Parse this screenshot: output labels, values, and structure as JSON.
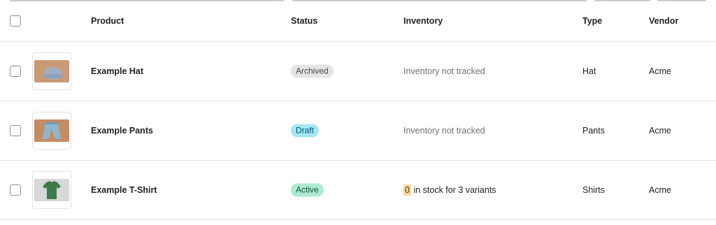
{
  "table": {
    "headers": {
      "product": "Product",
      "status": "Status",
      "inventory": "Inventory",
      "type": "Type",
      "vendor": "Vendor"
    },
    "rows": [
      {
        "product": "Example Hat",
        "status": "Archived",
        "inventory": "Inventory not tracked",
        "type": "Hat",
        "vendor": "Acme",
        "image": "hat-image"
      },
      {
        "product": "Example Pants",
        "status": "Draft",
        "inventory": "Inventory not tracked",
        "type": "Pants",
        "vendor": "Acme",
        "image": "pants-image"
      },
      {
        "product": "Example T-Shirt",
        "status": "Active",
        "inventory_count": "0",
        "inventory_suffix": "in stock for 3 variants",
        "type": "Shirts",
        "vendor": "Acme",
        "image": "t-shirt-image"
      }
    ]
  },
  "colors": {
    "archived_badge": "#e4e5e7",
    "draft_badge": "#a4e8f2",
    "active_badge": "#aee9d1",
    "low_stock_highlight": "#ffd79d"
  }
}
